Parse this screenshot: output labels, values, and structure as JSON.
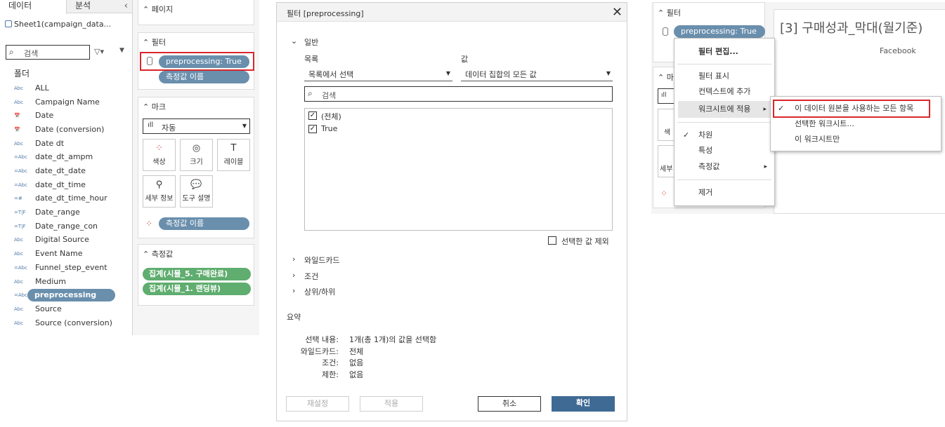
{
  "left_pane": {
    "tabs": [
      "데이터",
      "분석"
    ],
    "collapse_glyph": "‹",
    "source_icon": "database-icon",
    "source": "Sheet1(campaign_data...",
    "search_placeholder": "검색",
    "filter_glyph": "▽▾",
    "menu_glyph": "▼",
    "folder_label": "폴더",
    "fields": [
      {
        "type": "Abc",
        "name": "ALL"
      },
      {
        "type": "Abc",
        "name": "Campaign Name"
      },
      {
        "type": "📅",
        "name": "Date"
      },
      {
        "type": "📅",
        "name": "Date (conversion)"
      },
      {
        "type": "Abc",
        "name": "Date dt"
      },
      {
        "type": "=Abc",
        "name": "date_dt_ampm"
      },
      {
        "type": "=Abc",
        "name": "date_dt_date"
      },
      {
        "type": "=Abc",
        "name": "date_dt_time"
      },
      {
        "type": "=#",
        "name": "date_dt_time_hour"
      },
      {
        "type": "=T|F",
        "name": "Date_range"
      },
      {
        "type": "=T|F",
        "name": "Date_range_con"
      },
      {
        "type": "Abc",
        "name": "Digital Source"
      },
      {
        "type": "Abc",
        "name": "Event Name"
      },
      {
        "type": "=Abc",
        "name": "Funnel_step_event"
      },
      {
        "type": "Abc",
        "name": "Medium"
      },
      {
        "type": "=Abc",
        "name": "preprocessing"
      },
      {
        "type": "Abc",
        "name": "Source"
      },
      {
        "type": "Abc",
        "name": "Source (conversion)"
      }
    ]
  },
  "shelves": {
    "pages_header": "페이지",
    "filters_header": "필터",
    "filter_pill": "preprocessing: True",
    "filter_pill_icon": "cylinder-icon",
    "measure_names_pill": "측정값 이름",
    "marks_header": "마크",
    "mark_type": "자동",
    "mark_buttons": [
      {
        "glyph": "⁘",
        "label": "색상"
      },
      {
        "glyph": "◎",
        "label": "크기"
      },
      {
        "glyph": "T",
        "label": "레이블"
      },
      {
        "glyph": "⚲",
        "label": "세부 정보"
      },
      {
        "glyph": "💬",
        "label": "도구 설명"
      }
    ],
    "marks_measure_pill": "측정값 이름",
    "measures_header": "측정값",
    "measure_pills": [
      "집계(시뮬_5. 구매완료)",
      "집계(시뮬_1. 랜딩뷰)"
    ]
  },
  "dialog": {
    "title": "필터 [preprocessing]",
    "close_glyph": "✕",
    "general_label": "일반",
    "list_label": "목록",
    "list_value": "목록에서 선택",
    "value_label": "값",
    "value_value": "데이터 집합의 모든 값",
    "search_placeholder": "검색",
    "items": [
      {
        "label": "(전체)",
        "checked": true
      },
      {
        "label": "True",
        "checked": true
      }
    ],
    "check_glyph": "✓",
    "exclude_label": "선택한 값 제외",
    "sections": [
      "와일드카드",
      "조건",
      "상위/하위"
    ],
    "summary_label": "요약",
    "summary": [
      {
        "key": "선택 내용:",
        "value": "1개(총 1개)의 값을 선택함"
      },
      {
        "key": "와일드카드:",
        "value": "전체"
      },
      {
        "key": "조건:",
        "value": "없음"
      },
      {
        "key": "제한:",
        "value": "없음"
      }
    ],
    "buttons": {
      "reset": "재설정",
      "apply": "적용",
      "cancel": "취소",
      "ok": "확인"
    }
  },
  "context": {
    "filters_header": "필터",
    "filter_pill": "preprocessing: True",
    "sheet_title": "[3] 구매성과_막대(월기준)",
    "sheet_sub": "Facebook",
    "partial_header": "마",
    "partial_labels": [
      "색",
      "세부"
    ],
    "menu_items": [
      "필터 편집...",
      "필터 표시",
      "컨텍스트에 추가",
      "워크시트에 적용",
      "차원",
      "특성",
      "측정값",
      "제거"
    ],
    "submenu_items": [
      "이 데이터 원본을 사용하는 모든 항목",
      "선택한 워크시트...",
      "이 워크시트만"
    ],
    "check_glyph": "✓",
    "arrow_glyph": "▸"
  },
  "colors": {
    "pill_blue": "#6a8fad",
    "pill_green": "#5fad6f",
    "highlight": "#d9262b",
    "ok_button": "#3f6a94"
  }
}
